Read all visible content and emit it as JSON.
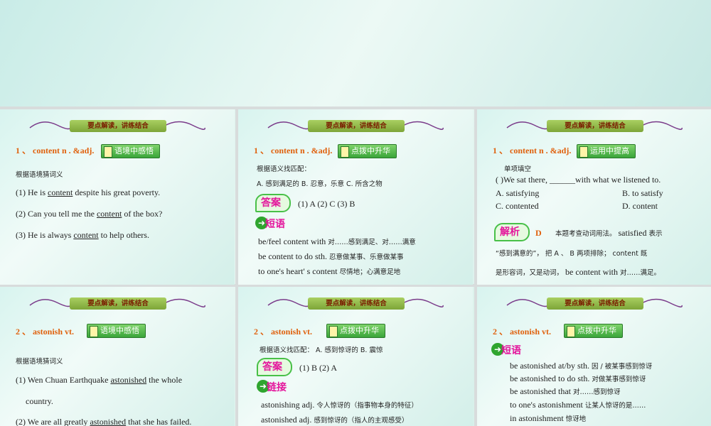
{
  "banner_label": "要点解读，讲练结合",
  "slides": {
    "s1": {
      "header": "1 、 content n .  &adj.",
      "tag": "语境中感悟",
      "instruction": "根据语境猜词义",
      "items": [
        {
          "pre": "(1) He is ",
          "word": "content",
          "post": " despite his great poverty."
        },
        {
          "pre": "(2) Can you tell me the ",
          "word": "content",
          "post": " of the box?"
        },
        {
          "pre": "(3) He is always ",
          "word": "content",
          "post": " to help others."
        }
      ]
    },
    "s2": {
      "header": "1 、 content n .  &adj.",
      "tag": "点拨中升华",
      "instruction": "根据语义找匹配：",
      "options": "A. 感到满足的    B. 忍意，乐意    C. 所含之物",
      "answer_badge": "答案",
      "answers": "(1) A    (2) C    (3) B",
      "phrase_badge": "短语",
      "phrases": [
        {
          "en": "be/feel content with",
          "cn": "对……感到满足、对……满意"
        },
        {
          "en": "be content to do sth.",
          "cn": "忍意做某事、乐意做某事"
        },
        {
          "en": "to one's heart' s content",
          "cn": "尽情地；心满意足地"
        }
      ]
    },
    "s3": {
      "header": "1 、 content n .  &adj.",
      "tag": "运用中提高",
      "instruction": "单项填空",
      "question": "(          )We sat there, ______with what we listened to.",
      "optA": "A. satisfying",
      "optB": "B. to satisfy",
      "optC": "C. contented",
      "optD": "D. content",
      "analysis_badge": "解析",
      "analysis_letter": "D",
      "analysis_l1_cn": "本题考查动词用法。",
      "analysis_l1_en": "satisfied",
      "analysis_l1_cn2": "表示",
      "analysis_l2": "“感到满意的”， 把 A 、 B 两项排除； content 既",
      "analysis_l3_cn": "是形容词，又是动词，",
      "analysis_l3_en": "be content with",
      "analysis_l3_cn2": "对……满足。"
    },
    "s4": {
      "header": "2 、   astonish vt.",
      "tag": "语境中感悟",
      "instruction": "根据语境猜词义",
      "item1_pre": "(1)  Wen  Chuan  Earthquake  ",
      "item1_word": "astonished",
      "item1_post": "  the  whole",
      "item1_cont": "country.",
      "item2_pre": "(2) We are all greatly ",
      "item2_word": "astonished",
      "item2_post": " that she has failed."
    },
    "s5": {
      "header": "2 、   astonish vt.",
      "tag": "点拨中升华",
      "instruction": "根据语义找匹配：  A. 感到惊讶的     B. 震惊",
      "answer_badge": "答案",
      "answers": "(1) B    (2) A",
      "link_badge": "链接",
      "links": [
        {
          "en": "astonishing adj.",
          "cn": "令人惊讶的（指事物本身的特征）"
        },
        {
          "en": "astonished adj.",
          "cn": "感到惊讶的（指人的主观感受）"
        }
      ]
    },
    "s6": {
      "header": "2 、   astonish vt.",
      "tag": "点拨中升华",
      "phrase_badge": "短语",
      "phrases": [
        {
          "en": "be astonished at/by sth.",
          "cn": "因 / 被某事感到惊讶"
        },
        {
          "en": "be astonished to do sth.",
          "cn": "对做某事感到惊讶"
        },
        {
          "en": "be astonished that",
          "cn": "对……感到惊讶"
        },
        {
          "en": "to one's astonishment",
          "cn": "让某人惊讶的是……"
        },
        {
          "en": "in astonishment",
          "cn": "惊讶地"
        }
      ]
    }
  },
  "colors": {
    "header": "#e0600c",
    "badge": "#e4169c",
    "tag_green": "#3aa53a"
  }
}
